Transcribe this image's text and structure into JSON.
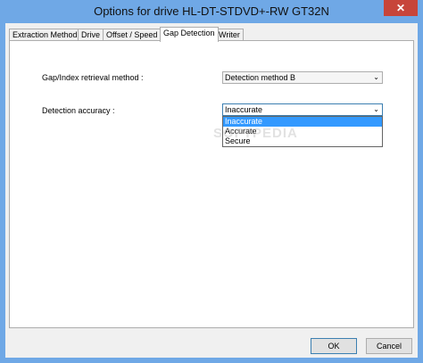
{
  "window": {
    "title": "Options for drive HL-DT-STDVD+-RW GT32N",
    "close_glyph": "✕"
  },
  "tabs": [
    {
      "label": "Extraction Method",
      "active": false
    },
    {
      "label": "Drive",
      "active": false
    },
    {
      "label": "Offset / Speed",
      "active": false
    },
    {
      "label": "Gap Detection",
      "active": true
    },
    {
      "label": "Writer",
      "active": false
    }
  ],
  "gap_detection": {
    "retrieval_label": "Gap/Index retrieval method :",
    "retrieval_value": "Detection method B",
    "accuracy_label": "Detection accuracy :",
    "accuracy_value": "Inaccurate",
    "accuracy_options": [
      "Inaccurate",
      "Accurate",
      "Secure"
    ],
    "arrow_glyph": "⌄"
  },
  "watermark": "SOFTPEDIA",
  "buttons": {
    "ok": "OK",
    "cancel": "Cancel"
  },
  "colors": {
    "titlebar": "#6fa8e6",
    "close": "#c7453a",
    "selection": "#3399ff"
  }
}
